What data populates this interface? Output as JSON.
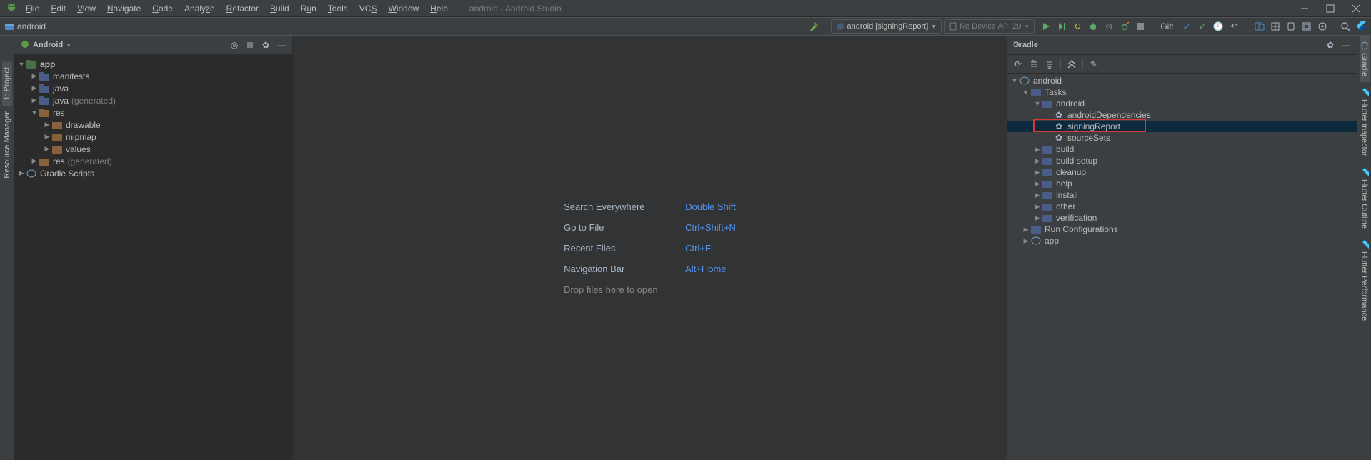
{
  "app_title": "android - Android Studio",
  "menu": [
    "File",
    "Edit",
    "View",
    "Navigate",
    "Code",
    "Analyze",
    "Refactor",
    "Build",
    "Run",
    "Tools",
    "VCS",
    "Window",
    "Help"
  ],
  "breadcrumb": "android",
  "run_config_label": "android [signingReport]",
  "device_label": "No Device API 29",
  "git_label": "Git:",
  "project_header": "Android",
  "project_tree": {
    "app": "app",
    "manifests": "manifests",
    "java1": "java",
    "java2": "java",
    "java2_note": "(generated)",
    "res": "res",
    "drawable": "drawable",
    "mipmap": "mipmap",
    "values": "values",
    "res2": "res",
    "res2_note": "(generated)",
    "gradle_scripts": "Gradle Scripts"
  },
  "hints": {
    "search_lbl": "Search Everywhere",
    "search_key": "Double Shift",
    "goto_lbl": "Go to File",
    "goto_key": "Ctrl+Shift+N",
    "recent_lbl": "Recent Files",
    "recent_key": "Ctrl+E",
    "nav_lbl": "Navigation Bar",
    "nav_key": "Alt+Home",
    "drop": "Drop files here to open"
  },
  "gradle_header": "Gradle",
  "gradle_tree": {
    "root": "android",
    "tasks": "Tasks",
    "task_android": "android",
    "androidDependencies": "androidDependencies",
    "signingReport": "signingReport",
    "sourceSets": "sourceSets",
    "build": "build",
    "build_setup": "build setup",
    "cleanup": "cleanup",
    "help": "help",
    "install": "install",
    "other": "other",
    "verification": "verification",
    "run_configs": "Run Configurations",
    "app": "app"
  },
  "left_tabs": {
    "project": "1: Project",
    "resmgr": "Resource Manager"
  },
  "right_tabs": {
    "gradle": "Gradle",
    "inspector": "Flutter Inspector",
    "outline": "Flutter Outline",
    "perf": "Flutter Performance"
  }
}
